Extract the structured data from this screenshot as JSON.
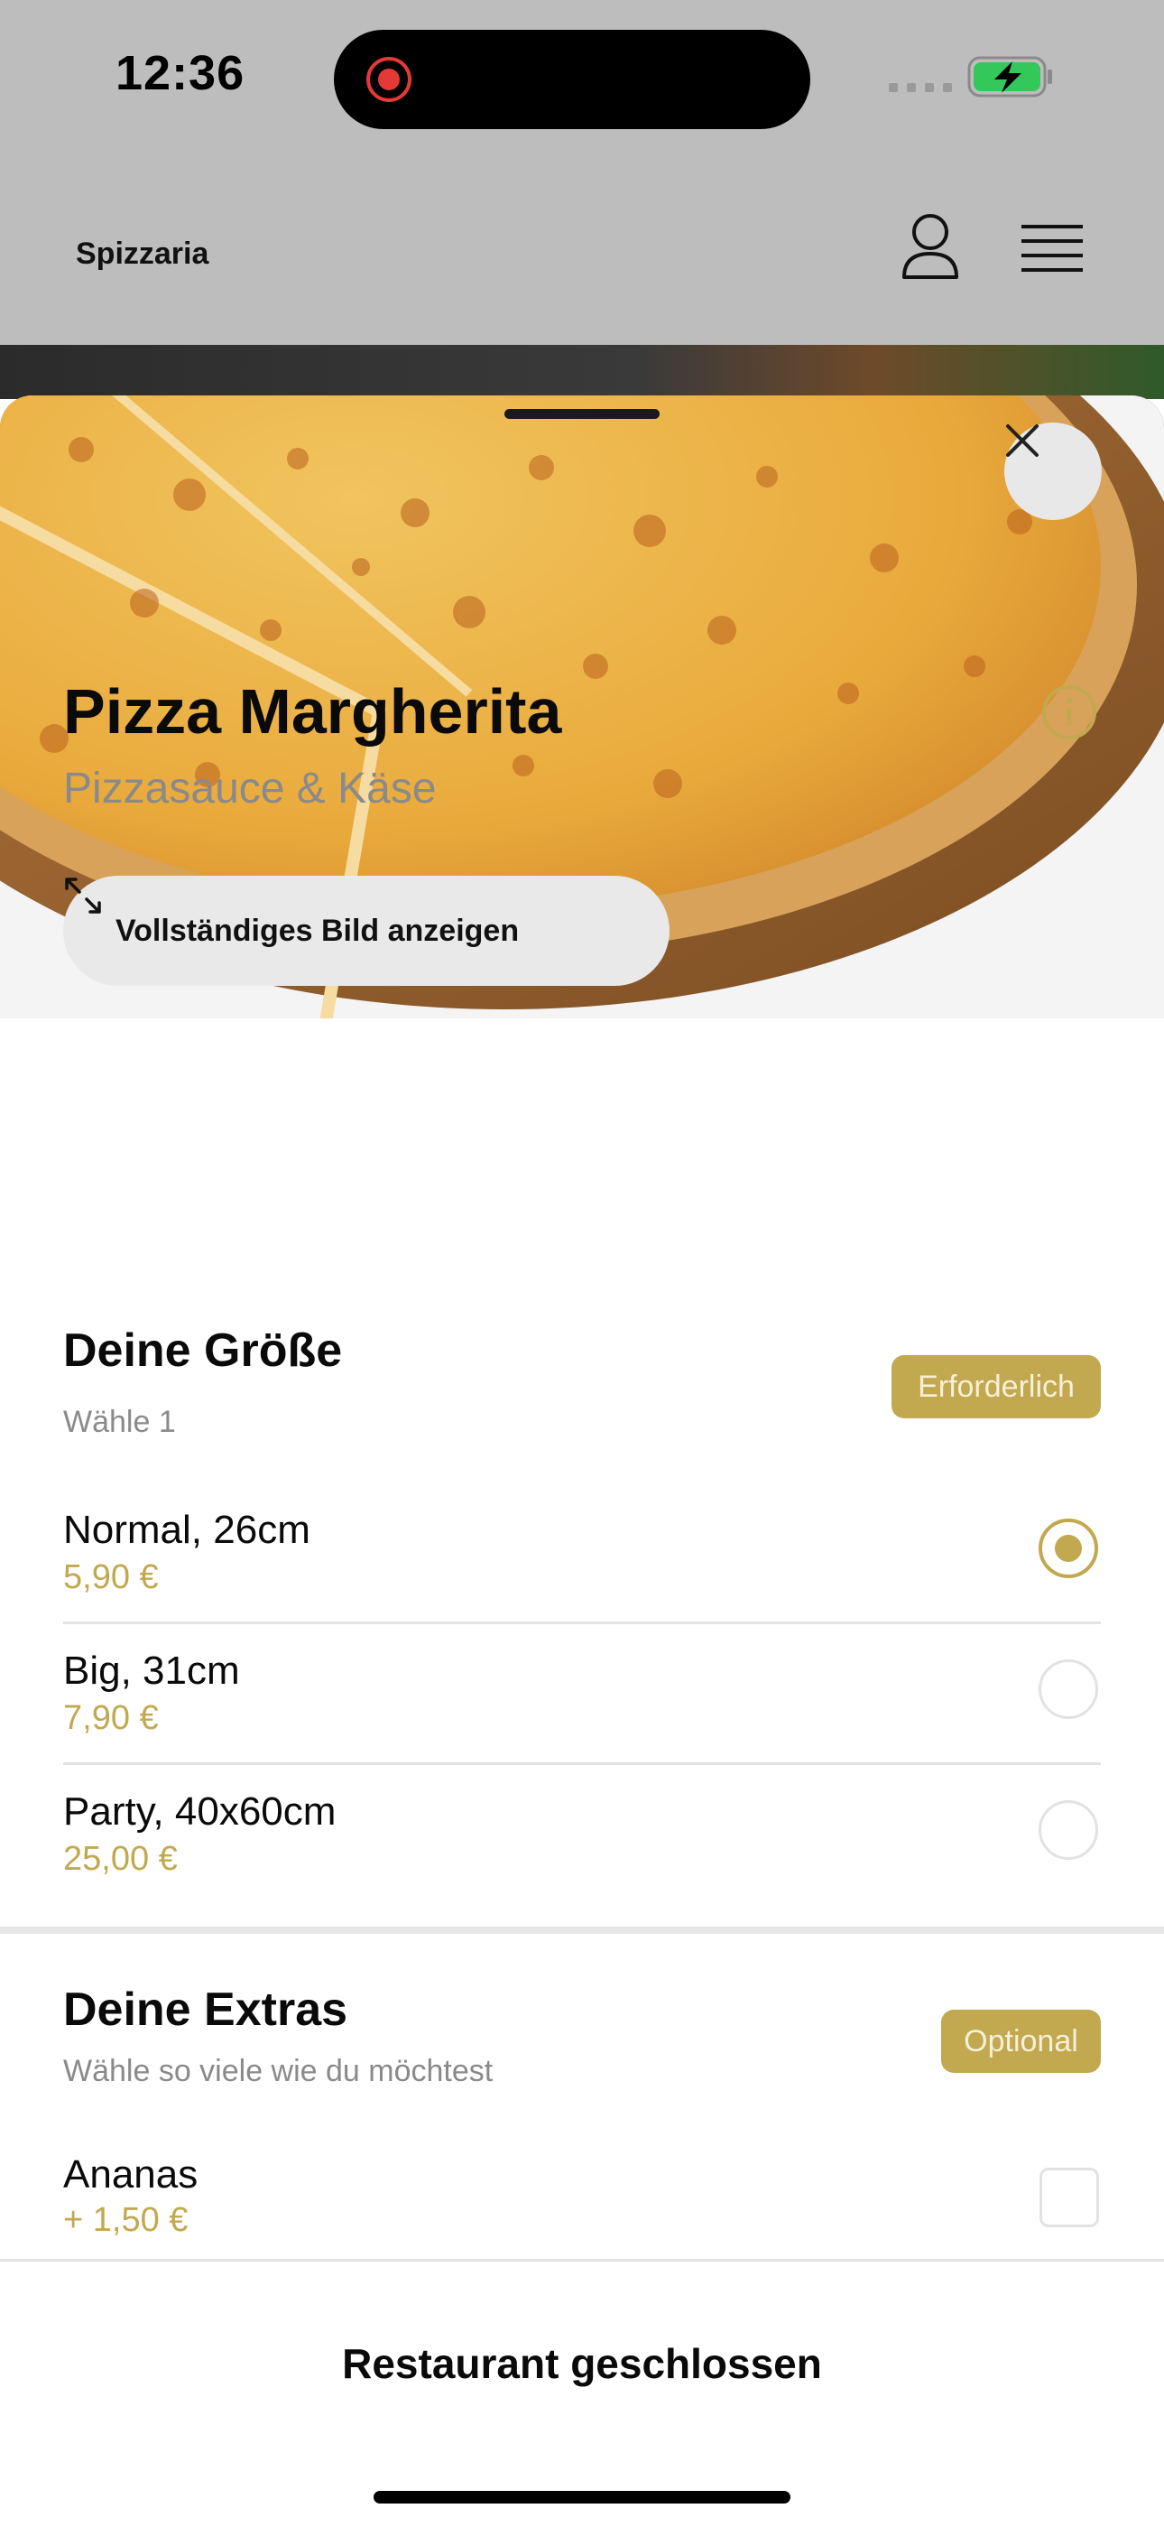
{
  "status_bar": {
    "time": "12:36"
  },
  "header": {
    "brand": "Spizzaria"
  },
  "product": {
    "full_image_label": "Vollständiges Bild anzeigen",
    "title": "Pizza Margherita",
    "subtitle": "Pizzasauce & Käse"
  },
  "size_section": {
    "title": "Deine Größe",
    "hint": "Wähle 1",
    "badge": "Erforderlich",
    "options": [
      {
        "name": "Normal, 26cm",
        "price": "5,90 €",
        "selected": true
      },
      {
        "name": "Big, 31cm",
        "price": "7,90 €",
        "selected": false
      },
      {
        "name": "Party, 40x60cm",
        "price": "25,00 €",
        "selected": false
      }
    ]
  },
  "extras_section": {
    "title": "Deine Extras",
    "hint": "Wähle so viele wie du möchtest",
    "badge": "Optional",
    "items": [
      {
        "name": "Ananas",
        "price": "+ 1,50 €",
        "checked": false
      }
    ]
  },
  "footer": {
    "label": "Restaurant geschlossen"
  },
  "colors": {
    "accent": "#c2a84f",
    "header_bg": "#bdbdbd",
    "battery": "#34c759"
  }
}
